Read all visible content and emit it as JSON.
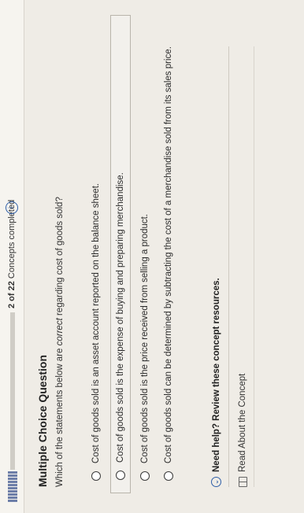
{
  "progress": {
    "segments_completed": 2,
    "text_count": "2 of 22",
    "text_label": "Concepts completed",
    "info_icon": "info-icon"
  },
  "question": {
    "title": "Multiple Choice Question",
    "prompt_pre": "Which of the statements below are ",
    "prompt_em": "correct",
    "prompt_post": " regarding cost of goods sold?"
  },
  "options": [
    {
      "text": "Cost of goods sold is an asset account reported on the balance sheet."
    },
    {
      "text": "Cost of goods sold is the expense of buying and preparing merchandise."
    },
    {
      "text": "Cost of goods sold is the price received from selling a product."
    },
    {
      "text": "Cost of goods sold can be determined by subtracting the cost of a merchandise sold from its sales price."
    }
  ],
  "help": {
    "label": "Need help? Review these concept resources.",
    "icon": "chevron-circle-icon"
  },
  "resource": {
    "label": "Read About the Concept",
    "icon": "book-icon"
  }
}
